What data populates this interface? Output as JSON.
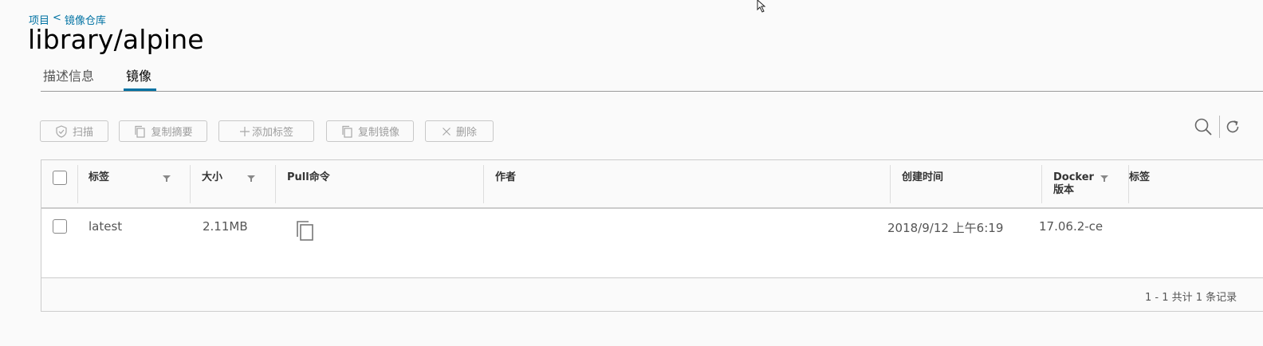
{
  "breadcrumb": {
    "project": "项目",
    "separator": "<",
    "repo": "镜像仓库"
  },
  "page_title": "library/alpine",
  "tabs": [
    {
      "label": "描述信息",
      "active": false
    },
    {
      "label": "镜像",
      "active": true
    }
  ],
  "toolbar": {
    "scan": "扫描",
    "copy_digest": "复制摘要",
    "add_tag": "添加标签",
    "copy_image": "复制镜像",
    "delete": "删除"
  },
  "grid": {
    "columns": [
      "标签",
      "大小",
      "Pull命令",
      "作者",
      "创建时间",
      "Docker 版本",
      "标签"
    ],
    "docker_col": {
      "line1": "Docker",
      "line2": "版本"
    },
    "rows": [
      {
        "tag": "latest",
        "size": "2.11MB",
        "pull_command_icon": "copy-icon",
        "author": "",
        "created": "2018/9/12 上午6:19",
        "docker_version": "17.06.2-ce",
        "labels": ""
      }
    ],
    "footer": "1 - 1 共计 1 条记录"
  },
  "colors": {
    "accent": "#0072a3",
    "disabled": "#9d9d9d",
    "border": "#cccccc"
  }
}
